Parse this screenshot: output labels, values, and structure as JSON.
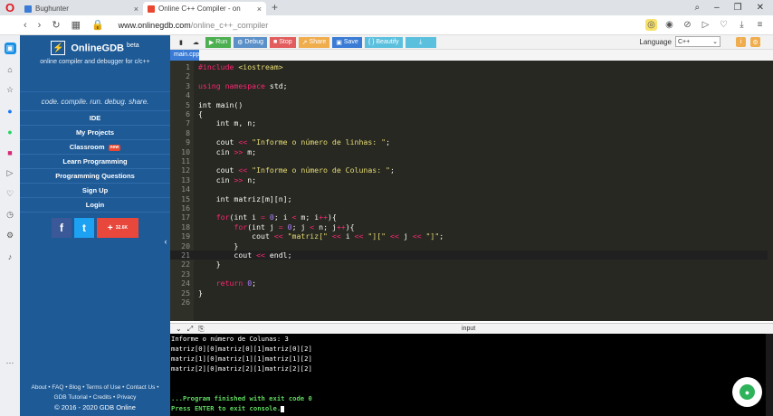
{
  "browser": {
    "tabs": [
      {
        "label": "Bughunter",
        "active": false
      },
      {
        "label": "Online C++ Compiler - on",
        "active": true
      }
    ],
    "new_tab": "+",
    "url_domain": "www.onlinegdb.com",
    "url_path": "/online_c++_compiler",
    "window_controls": [
      "search-icon",
      "minimize-icon",
      "maximize-icon",
      "close-icon"
    ]
  },
  "gdb": {
    "brand": "OnlineGDB",
    "brand_sup": "beta",
    "subtitle": "online compiler and debugger for c/c++",
    "slogan": "code. compile. run. debug. share.",
    "nav": [
      "IDE",
      "My Projects",
      "Classroom",
      "Learn Programming",
      "Programming Questions",
      "Sign Up",
      "Login"
    ],
    "classroom_badge": "new",
    "social": {
      "fb": "f",
      "tw": "t",
      "plus": "+",
      "plus_count": "32.6K"
    },
    "footer": {
      "line1": "About • FAQ • Blog • Terms of Use • Contact Us •",
      "line2": "GDB Tutorial • Credits • Privacy",
      "copyright": "© 2016 - 2020 GDB Online"
    }
  },
  "toolbar": {
    "run": "Run",
    "debug": "Debug",
    "stop": "Stop",
    "share": "Share",
    "save": "Save",
    "beautify": "{ } Beautify",
    "language_label": "Language",
    "language_value": "C++"
  },
  "editor": {
    "file_tab": "main.cpp",
    "lines": [
      "#include <iostream>",
      "",
      "using namespace std;",
      "",
      "int main()",
      "{",
      "    int m, n;",
      "",
      "    cout << \"Informe o número de linhas: \";",
      "    cin >> m;",
      "",
      "    cout << \"Informe o número de Colunas: \";",
      "    cin >> n;",
      "",
      "    int matriz[m][n];",
      "",
      "    for(int i = 0; i < m; i++){",
      "        for(int j = 0; j < n; j++){",
      "            cout << \"matriz[\" << i << \"][\" << j << \"]\";",
      "        }",
      "        cout << endl;",
      "    }",
      "",
      "    return 0;",
      "}",
      ""
    ]
  },
  "console": {
    "input_label": "input",
    "lines": [
      "Informe o número de Colunas: 3",
      "matriz[0][0]matriz[0][1]matriz[0][2]",
      "matriz[1][0]matriz[1][1]matriz[1][2]",
      "matriz[2][0]matriz[2][1]matriz[2][2]",
      "",
      "",
      "...Program finished with exit code 0",
      "Press ENTER to exit console."
    ]
  }
}
